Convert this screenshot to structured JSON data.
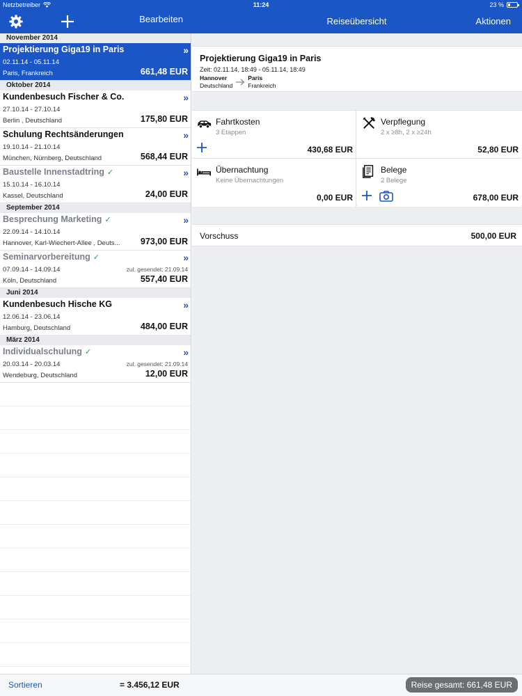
{
  "status": {
    "carrier": "Netzbetreiber",
    "time": "11:24",
    "battery": "23 %"
  },
  "nav": {
    "edit_label": "Bearbeiten",
    "detail_title": "Reiseübersicht",
    "actions_label": "Aktionen"
  },
  "sections": [
    {
      "header": "November 2014",
      "trips": [
        {
          "name": "Projektierung Giga19 in Paris",
          "dates": "02.11.14 - 05.11.14",
          "place": "Paris, Frankreich",
          "amount": "661,48 EUR",
          "done": false,
          "sent": "",
          "selected": true
        }
      ]
    },
    {
      "header": "Oktober 2014",
      "trips": [
        {
          "name": "Kundenbesuch Fischer & Co.",
          "dates": "27.10.14 - 27.10.14",
          "place": "Berlin , Deutschland",
          "amount": "175,80 EUR",
          "done": false,
          "sent": "",
          "selected": false
        },
        {
          "name": "Schulung Rechtsänderungen",
          "dates": "19.10.14 - 21.10.14",
          "place": "München, Nürnberg, Deutschland",
          "amount": "568,44 EUR",
          "done": false,
          "sent": "",
          "selected": false
        },
        {
          "name": "Baustelle Innenstadtring",
          "dates": "15.10.14 - 16.10.14",
          "place": "Kassel, Deutschland",
          "amount": "24,00 EUR",
          "done": true,
          "sent": "",
          "selected": false
        }
      ]
    },
    {
      "header": "September 2014",
      "trips": [
        {
          "name": "Besprechung Marketing",
          "dates": "22.09.14 - 14.10.14",
          "place": "Hannover, Karl-Wiechert-Allee , Deuts...",
          "amount": "973,00 EUR",
          "done": true,
          "sent": "",
          "selected": false
        },
        {
          "name": "Seminarvorbereitung",
          "dates": "07.09.14 - 14.09.14",
          "place": "Köln, Deutschland",
          "amount": "557,40 EUR",
          "done": true,
          "sent": "zul. gesendet: 21.09.14",
          "selected": false
        }
      ]
    },
    {
      "header": "Juni 2014",
      "trips": [
        {
          "name": "Kundenbesuch Hische KG",
          "dates": "12.06.14 - 23.06.14",
          "place": "Hamburg, Deutschland",
          "amount": "484,00 EUR",
          "done": false,
          "sent": "",
          "selected": false
        }
      ]
    },
    {
      "header": "März 2014",
      "trips": [
        {
          "name": "Individualschulung",
          "dates": "20.03.14 - 20.03.14",
          "place": "Wendeburg, Deutschland",
          "amount": "12,00 EUR",
          "done": true,
          "sent": "zul. gesendet: 21.09.14",
          "selected": false
        }
      ]
    }
  ],
  "bottom": {
    "sort_label": "Sortieren",
    "list_total": "= 3.456,12 EUR",
    "trip_total": "Reise gesamt: 661,48 EUR"
  },
  "detail": {
    "title": "Projektierung Giga19 in Paris",
    "time": "Zeit: 02.11.14, 18:49 - 05.11.14, 18:49",
    "from_city": "Hannover",
    "from_country": "Deutschland",
    "to_city": "Paris",
    "to_country": "Frankreich",
    "tiles": {
      "travel": {
        "label": "Fahrtkosten",
        "sub": "3 Etappen",
        "amount": "430,68 EUR"
      },
      "meals": {
        "label": "Verpflegung",
        "sub": "2 x ≥8h, 2 x ≥24h",
        "amount": "52,80 EUR"
      },
      "lodging": {
        "label": "Übernachtung",
        "sub": "Keine Übernachtungen",
        "amount": "0,00 EUR"
      },
      "receipts": {
        "label": "Belege",
        "sub": "2 Belege",
        "amount": "678,00 EUR"
      }
    },
    "advance": {
      "label": "Vorschuss",
      "amount": "500,00 EUR"
    }
  },
  "colors": {
    "accent": "#1a56c6",
    "check": "#19a34b"
  },
  "icons": [
    "gear-icon",
    "plus-icon",
    "car-icon",
    "cutlery-icon",
    "bed-icon",
    "receipt-icon",
    "camera-icon",
    "double-chevron-icon",
    "checkmark-icon",
    "arrow-right-icon",
    "wifi-icon",
    "battery-icon"
  ]
}
